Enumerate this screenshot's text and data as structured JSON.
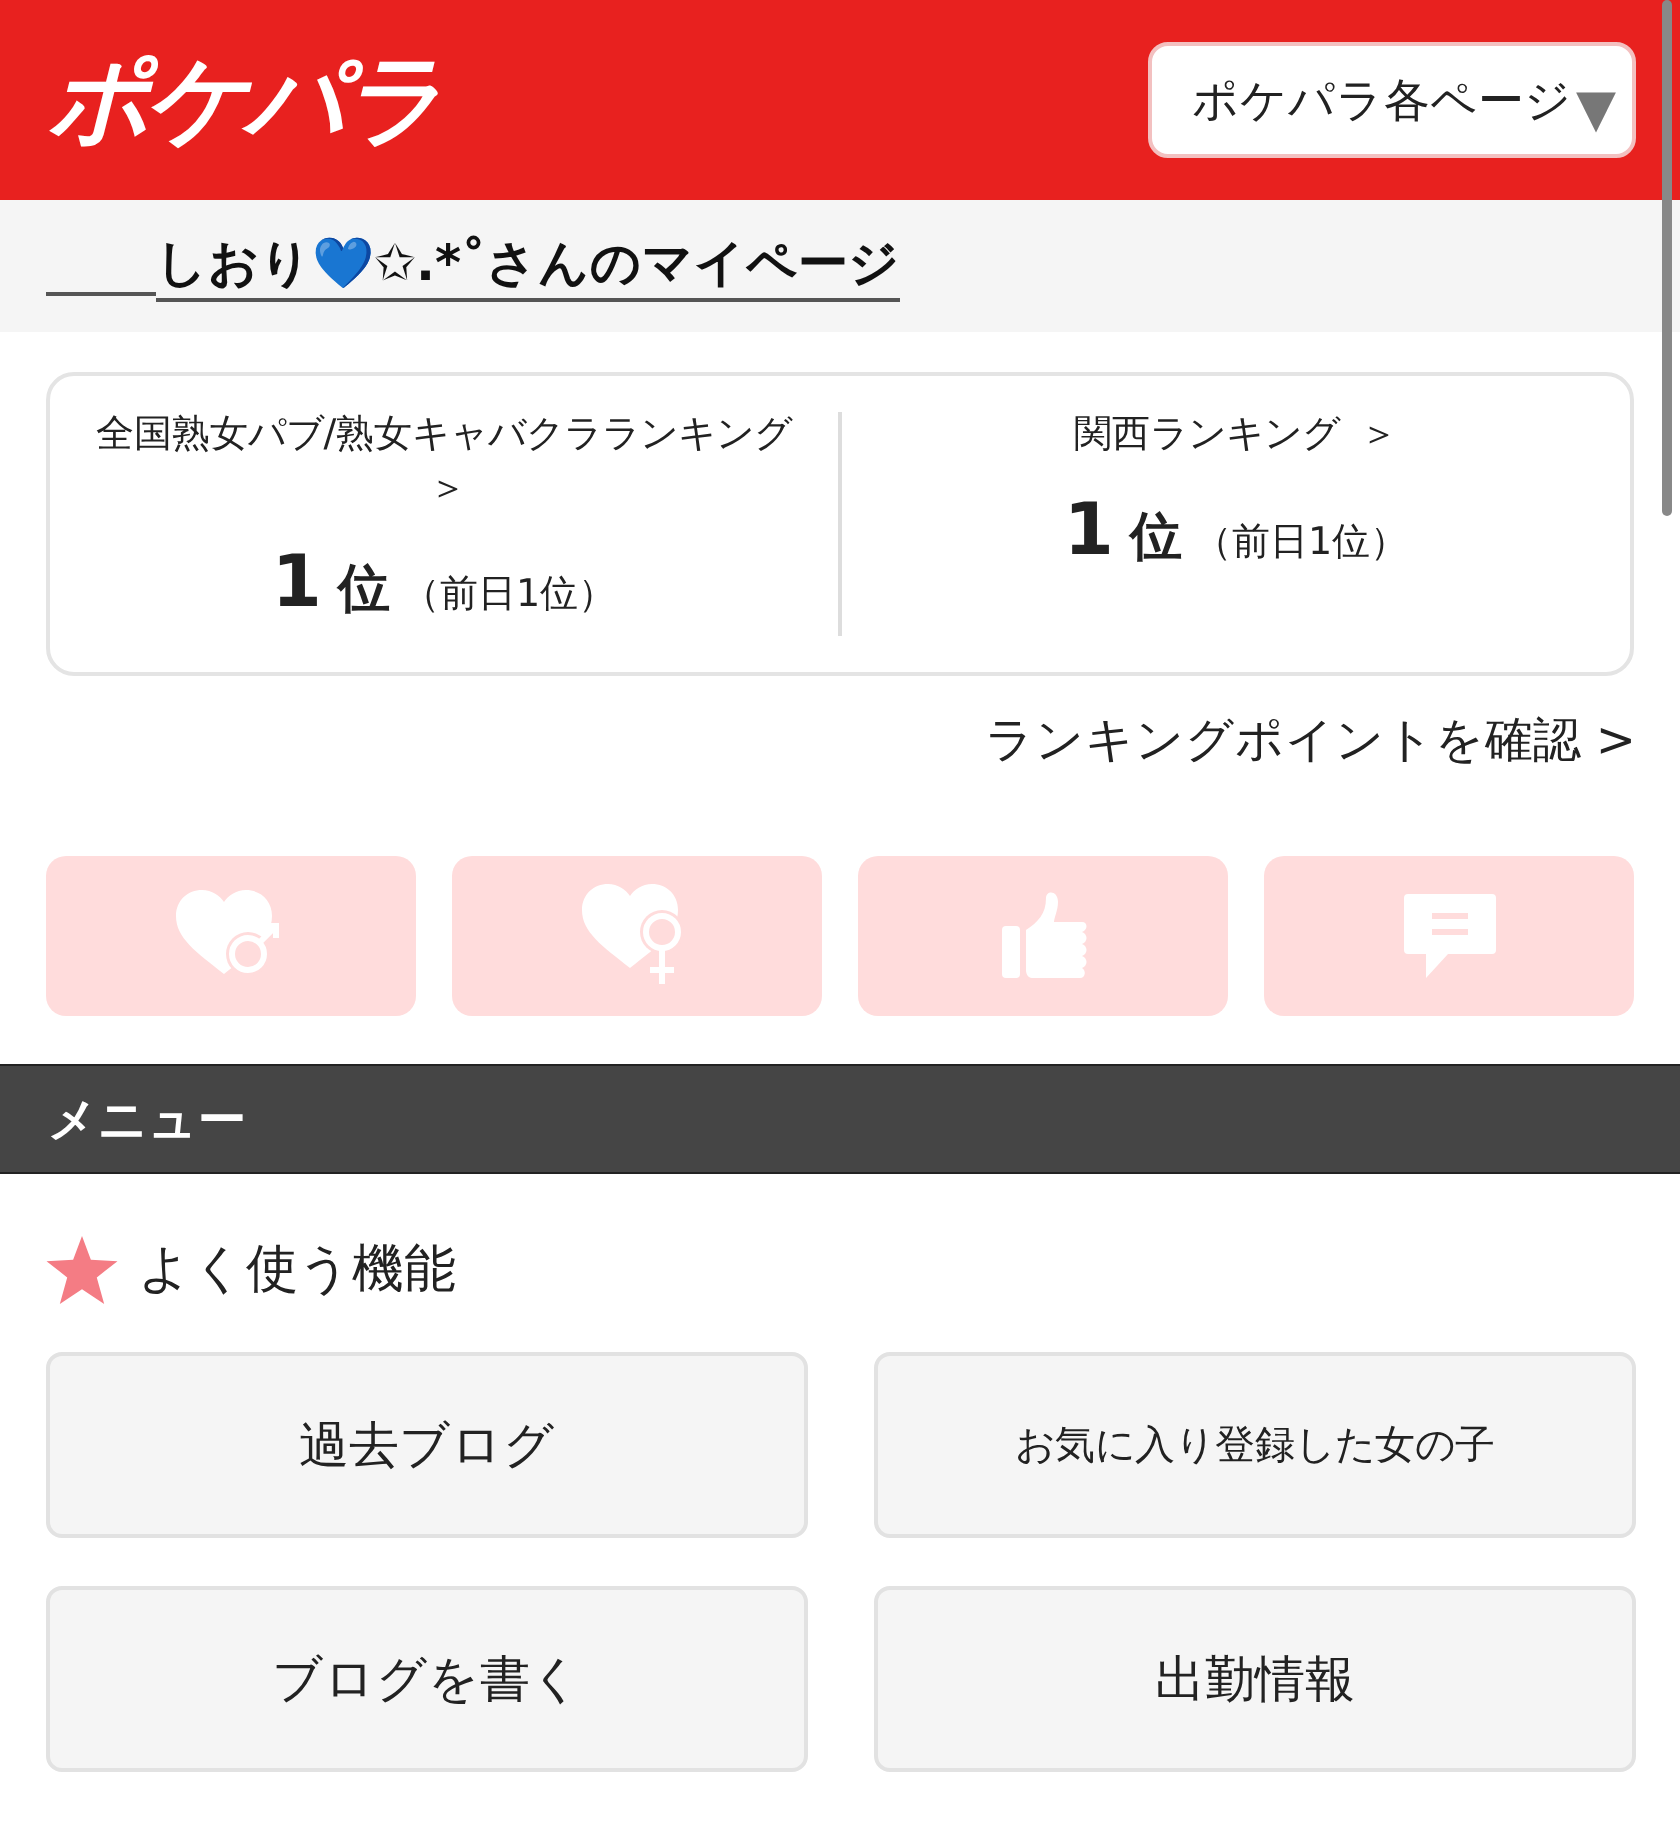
{
  "header": {
    "logo": "ポケパラ",
    "page_menu": {
      "label": "ポケパラ各ページ",
      "caret": "▼"
    }
  },
  "title": "しおり💙✩.*˚さんのマイページ",
  "rankings": [
    {
      "label": "全国熟女パブ/熟女キャバクラランキング",
      "arrow": "＞",
      "rank": "1",
      "unit": "位",
      "previous": "（前日1位）"
    },
    {
      "label": "関西ランキング",
      "arrow": "＞",
      "rank": "1",
      "unit": "位",
      "previous": "（前日1位）"
    }
  ],
  "ranking_points_link": "ランキングポイントを確認 >",
  "action_buttons": [
    {
      "kind": "heart-male"
    },
    {
      "kind": "heart-female"
    },
    {
      "kind": "thumbs-up"
    },
    {
      "kind": "chat"
    }
  ],
  "menu_header": "メニュー",
  "section_title": "よく使う機能",
  "menu_buttons": [
    {
      "label": "過去ブログ",
      "small": false
    },
    {
      "label": "お気に入り登録した女の子",
      "small": true
    },
    {
      "label": "ブログを書く",
      "small": false
    },
    {
      "label": "出勤情報",
      "small": false
    }
  ]
}
